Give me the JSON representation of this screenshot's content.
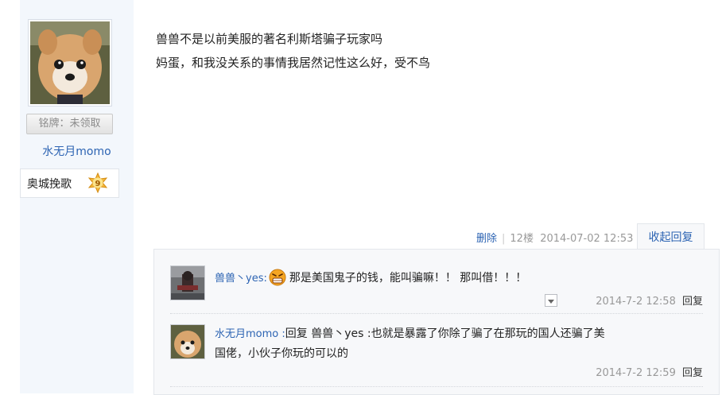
{
  "user": {
    "badge_label": "铭牌：未领取",
    "name": "水无月momo",
    "level_name": "奥城挽歌",
    "level_number": "9"
  },
  "post": {
    "lines": [
      "兽兽不是以前美服的著名利斯塔骗子玩家吗",
      "妈蛋，和我没关系的事情我居然记性这么好，受不鸟"
    ]
  },
  "floor_meta": {
    "delete_label": "删除",
    "floor": "12楼",
    "timestamp": "2014-07-02 12:53",
    "collapse_label": "收起回复"
  },
  "replies": [
    {
      "user": "兽兽丶yes",
      "separator": ":",
      "text": "那是美国鬼子的钱，能叫骗嘛！！ 那叫借！！！",
      "emoji": "angry-face-icon",
      "time": "2014-7-2 12:58",
      "reply_label": "回复"
    },
    {
      "user": "水无月momo",
      "separator": " :",
      "text_prefix": "回复 ",
      "mention": "兽兽丶yes",
      "text_line1": " :也就是暴露了你除了骗了在那玩的国人还骗了美",
      "text_line2": "国佬，小伙子你玩的可以的",
      "time": "2014-7-2 12:59",
      "reply_label": "回复"
    }
  ],
  "colors": {
    "link": "#2d64b3",
    "sidebar_bg": "#f3f7fc",
    "panel_bg": "#f7f8fa",
    "meta_gray": "#999999"
  }
}
